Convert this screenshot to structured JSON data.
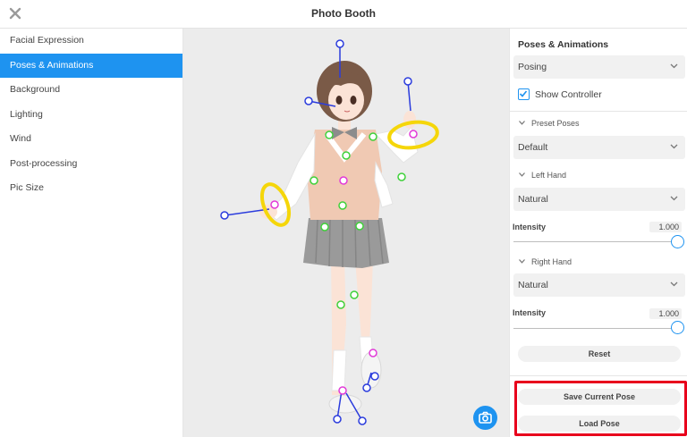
{
  "window": {
    "title": "Photo Booth",
    "close_icon": "close-icon"
  },
  "sidebar": {
    "items": [
      {
        "label": "Facial Expression",
        "active": false
      },
      {
        "label": "Poses & Animations",
        "active": true
      },
      {
        "label": "Background",
        "active": false
      },
      {
        "label": "Lighting",
        "active": false
      },
      {
        "label": "Wind",
        "active": false
      },
      {
        "label": "Post-processing",
        "active": false
      },
      {
        "label": "Pic Size",
        "active": false
      }
    ]
  },
  "viewport": {
    "camera_icon": "camera-icon"
  },
  "panel": {
    "title": "Poses & Animations",
    "mode_select": {
      "value": "Posing"
    },
    "show_controller": {
      "label": "Show Controller",
      "checked": true
    },
    "preset_poses": {
      "label": "Preset Poses",
      "value": "Default"
    },
    "left_hand": {
      "label": "Left Hand",
      "value": "Natural",
      "intensity_label": "Intensity",
      "intensity": "1.000",
      "intensity_fraction": 1.0
    },
    "right_hand": {
      "label": "Right Hand",
      "value": "Natural",
      "intensity_label": "Intensity",
      "intensity": "1.000",
      "intensity_fraction": 1.0
    },
    "reset_label": "Reset",
    "save_label": "Save Current Pose",
    "load_label": "Load Pose"
  },
  "colors": {
    "accent": "#1e93f0",
    "highlight": "#e8001c",
    "ring": "#f5d60a",
    "handle_blue": "#2b3cdd",
    "handle_green": "#3fd13a",
    "handle_magenta": "#e23ad8"
  }
}
